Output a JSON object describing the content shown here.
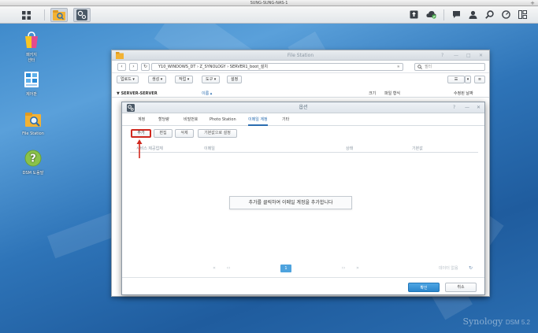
{
  "window": {
    "title": "SUNG-SUNG-NAS-1",
    "plus": "+"
  },
  "desktop": {
    "icons": [
      {
        "label": "패키지\n센터",
        "name": "package-center"
      },
      {
        "label": "제어판",
        "name": "control-panel"
      },
      {
        "label": "File Station",
        "name": "file-station"
      },
      {
        "label": "DSM 도움말",
        "name": "dsm-help"
      }
    ]
  },
  "file_station": {
    "title": "File Station",
    "path": "Y10_WINDOWS_DT  ›  Z_SYNOLOGY  ›  SERVER1_boot_설치",
    "search_placeholder": "필터",
    "toolbar": [
      "업로드 ▾",
      "생성 ▾",
      "작업 ▾",
      "도구 ▾",
      "설정"
    ],
    "tree_root": "▼ SERVER-SERVER",
    "columns": {
      "name": "이름 ▴",
      "size": "크기",
      "type": "파일 형식",
      "modified": "수정된 날짜"
    }
  },
  "dialog": {
    "title": "옵션",
    "tabs": [
      "계정",
      "할당량",
      "비밀번호",
      "Photo Station",
      "이메일 계정",
      "기타"
    ],
    "active_tab": "이메일 계정",
    "buttons": {
      "add": "추가",
      "edit": "편집",
      "delete": "삭제",
      "set_default": "기본값으로 설정"
    },
    "columns": {
      "provider": "서비스 제공업체",
      "email": "이메일",
      "status": "상태",
      "default": "기본값"
    },
    "empty_message": "추가를 클릭하여 이메일 계정을 추가합니다",
    "pager": {
      "first": "«",
      "prev": "‹‹",
      "current": "1",
      "next": "››",
      "last": "»",
      "no_data": "데이터 없음"
    },
    "ok": "확인",
    "cancel": "취소"
  },
  "branding": {
    "brand": "Synology",
    "version": "DSM 5.2"
  },
  "colors": {
    "accent": "#2a6db0",
    "highlight": "#d0281e",
    "primary_button": "#2b86cc"
  }
}
